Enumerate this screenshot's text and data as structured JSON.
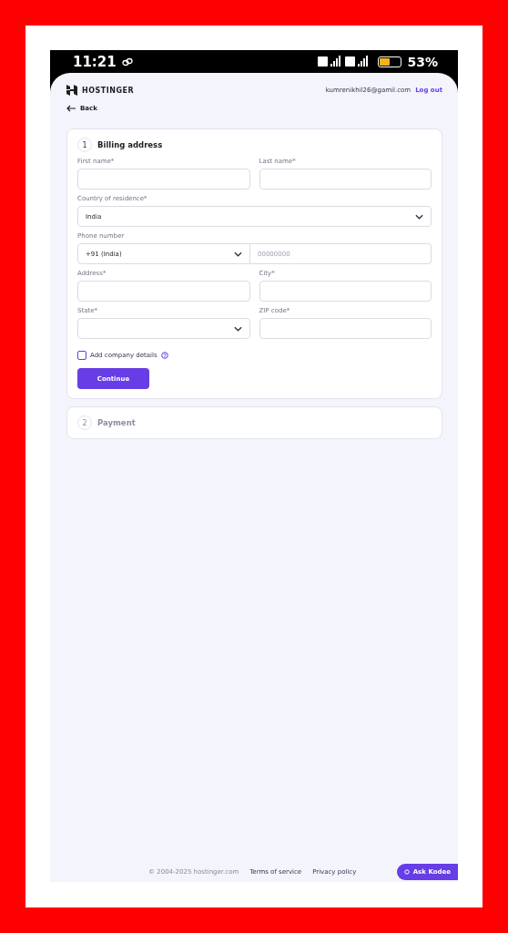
{
  "status_bar": {
    "time": "11:21",
    "battery": "53%"
  },
  "header": {
    "brand": "HOSTINGER",
    "email": "kumrenikhil26@gamil.com",
    "logout": "Log out"
  },
  "back": "Back",
  "steps": [
    {
      "number": "1",
      "title": "Billing address",
      "active": true,
      "rows": [
        [
          {
            "kind": "text",
            "label": "First name*"
          },
          {
            "kind": "text",
            "label": "Last name*"
          }
        ],
        [
          {
            "kind": "select",
            "label": "Country of residence*",
            "value": "India"
          }
        ],
        [
          {
            "kind": "phone",
            "label": "Phone number",
            "code": "+91 (India)",
            "placeholder": "00000000"
          }
        ],
        [
          {
            "kind": "text",
            "label": "Address*"
          },
          {
            "kind": "text",
            "label": "City*"
          }
        ],
        [
          {
            "kind": "select",
            "label": "State*"
          },
          {
            "kind": "text",
            "label": "ZIP code*"
          }
        ]
      ],
      "checkbox": {
        "label": "Add company details",
        "checked": false
      },
      "button": "Continue"
    },
    {
      "number": "2",
      "title": "Payment",
      "active": false
    }
  ],
  "footer": {
    "copyright": "© 2004-2025 hostinger.com",
    "links": [
      "Terms of service",
      "Privacy policy"
    ]
  },
  "chat_button": "Ask Kodee"
}
